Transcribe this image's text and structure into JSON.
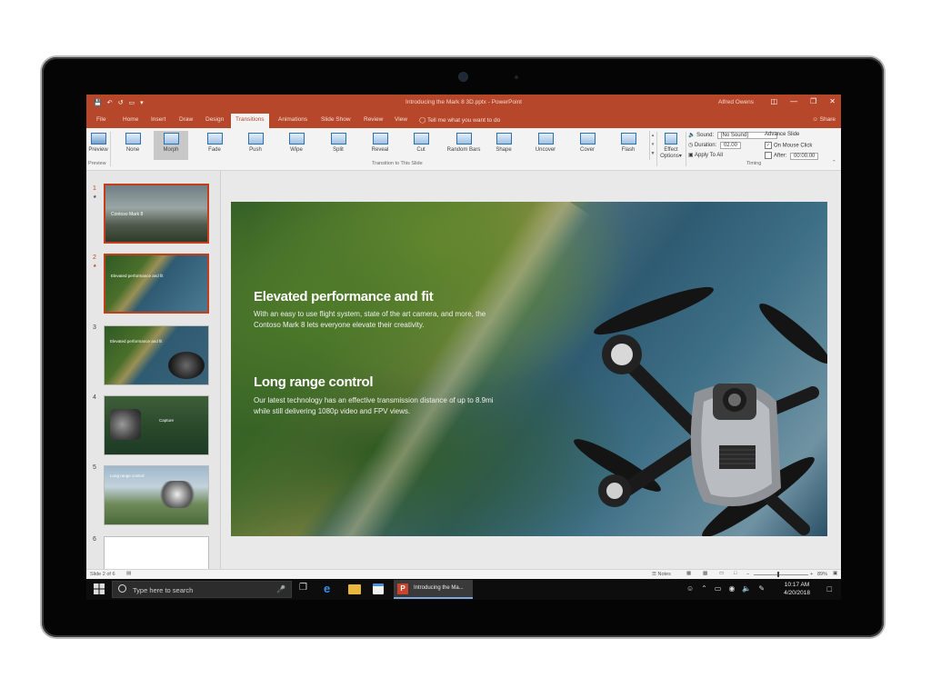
{
  "titlebar": {
    "document_title": "Introducing the Mark 8 3D.pptx",
    "app_name": "PowerPoint",
    "user_name": "Alfred Owens"
  },
  "tabs": {
    "items": [
      "File",
      "Home",
      "Insert",
      "Draw",
      "Design",
      "Transitions",
      "Animations",
      "Slide Show",
      "Review",
      "View"
    ],
    "active": "Transitions",
    "tell_me": "Tell me what you want to do",
    "share": "Share"
  },
  "ribbon": {
    "preview_label": "Preview",
    "preview_group": "Preview",
    "transitions": [
      "None",
      "Morph",
      "Fade",
      "Push",
      "Wipe",
      "Split",
      "Reveal",
      "Cut",
      "Random Bars",
      "Shape",
      "Uncover",
      "Cover",
      "Flash"
    ],
    "selected_transition": "Morph",
    "transitions_group": "Transition to This Slide",
    "effect_options_line1": "Effect",
    "effect_options_line2": "Options",
    "sound_label": "Sound:",
    "sound_value": "[No Sound]",
    "duration_label": "Duration:",
    "duration_value": "02.00",
    "apply_all": "Apply To All",
    "advance_label": "Advance Slide",
    "on_mouse_click": "On Mouse Click",
    "after_label": "After:",
    "after_value": "00:00.00",
    "timing_group": "Timing"
  },
  "slides": {
    "numbers": [
      "1",
      "2",
      "3",
      "4",
      "5",
      "6"
    ],
    "thumb1_title": "Contoso Mark 8",
    "thumb2_title": "Elevated performance and fit",
    "thumb3_title": "Elevated performance and fit",
    "thumb4_title": "Capture",
    "thumb5_title": "Long range control"
  },
  "slide": {
    "heading1": "Elevated performance and fit",
    "body1": "With an easy to use flight system, state of the art camera, and more, the Contoso Mark 8 lets everyone elevate their creativity.",
    "heading2": "Long range control",
    "body2": "Our latest technology has an effective transmission distance of up to 8.9mi while still delivering 1080p video and FPV views."
  },
  "statusbar": {
    "slide_info": "Slide 2 of 6",
    "notes": "Notes",
    "zoom": "89%"
  },
  "taskbar": {
    "search_placeholder": "Type here to search",
    "app_task": "Introducing the Ma...",
    "time": "10:17 AM",
    "date": "4/20/2018"
  },
  "colors": {
    "accent": "#b7472a",
    "selection": "#c43e1c"
  }
}
